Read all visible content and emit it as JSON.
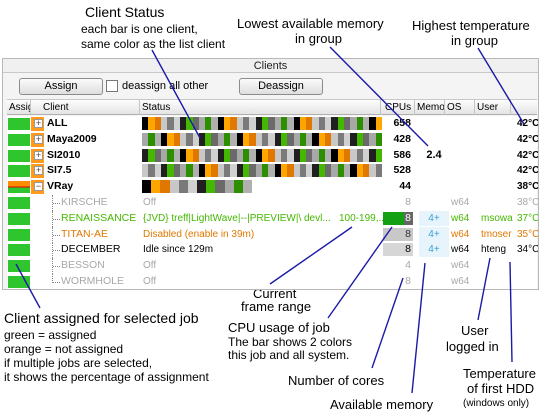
{
  "annotations": {
    "client_status": {
      "title": "Client Status",
      "line1": "each bar is one client,",
      "line2": "same color as the list client"
    },
    "lowest_memory": {
      "line1": "Lowest available memory",
      "line2": "in group"
    },
    "highest_temp": {
      "line1": "Highest temperature",
      "line2": "in group"
    },
    "frame_range": {
      "line1": "Current",
      "line2": "frame range"
    },
    "cpu_usage": {
      "line1": "CPU usage of job",
      "line2": "The bar shows 2 colors",
      "line3": "this job and all system."
    },
    "user": {
      "line1": "User",
      "line2": "logged in"
    },
    "client_assigned": {
      "line1": "Client assigned for selected job",
      "line2": "green = assigned",
      "line3": "orange = not assigned",
      "line4": "if multiple jobs are selected,",
      "line5": "it shows the percentage of assignment"
    },
    "cores": {
      "line1": "Number of cores"
    },
    "available_memory": {
      "line1": "Available memory"
    },
    "temp_hdd": {
      "line1": "Temperature",
      "line2": "of first HDD",
      "line3": "(windows only)"
    }
  },
  "panel": {
    "title": "Clients",
    "assign_label": "Assign",
    "deassign_all_label": "deassign all other",
    "deassign_label": "Deassign",
    "columns": [
      "Assig",
      "Client",
      "Status",
      "CPUs",
      "Memo",
      "OS",
      "User"
    ]
  },
  "groups": [
    {
      "name": "ALL",
      "cpus": "658",
      "mem": "",
      "temp": "42°C"
    },
    {
      "name": "Maya2009",
      "cpus": "428",
      "mem": "",
      "temp": "42°C"
    },
    {
      "name": "SI2010",
      "cpus": "586",
      "mem": "2.4",
      "temp": "42°C"
    },
    {
      "name": "SI7.5",
      "cpus": "528",
      "mem": "",
      "temp": "42°C"
    },
    {
      "name": "VRay",
      "cpus": "44",
      "mem": "",
      "temp": "38°C"
    }
  ],
  "clients": [
    {
      "name": "KIRSCHE",
      "status": "Off",
      "cpus": "8",
      "mem": "",
      "os": "w64",
      "user": "",
      "temp": "38°C",
      "color": "#a8a8a8"
    },
    {
      "name": "RENAISSANCE",
      "status": "{JVD} treff|LightWave|--|PREVIEW|\\ devl...",
      "range": "100-199,...",
      "cpus": "8",
      "mem": "4+",
      "os": "w64",
      "user": "msowa",
      "temp": "37°C",
      "color": "#44b800"
    },
    {
      "name": "TITAN-AE",
      "status": "Disabled (enable in 39m)",
      "cpus": "8",
      "mem": "4+",
      "os": "w64",
      "user": "tmoser",
      "temp": "35°C",
      "color": "#e07800"
    },
    {
      "name": "DECEMBER",
      "status": "Idle since 129m",
      "cpus": "8",
      "mem": "4+",
      "os": "w64",
      "user": "hteng",
      "temp": "34°C",
      "color": "#000000"
    },
    {
      "name": "BESSON",
      "status": "Off",
      "cpus": "4",
      "mem": "",
      "os": "w64",
      "user": "",
      "temp": "",
      "color": "#a8a8a8"
    },
    {
      "name": "WORMHOLE",
      "status": "Off",
      "cpus": "8",
      "mem": "",
      "os": "w64",
      "user": "",
      "temp": "",
      "color": "#a8a8a8"
    }
  ],
  "colors": {
    "assigned": "#2fc52f",
    "not_assigned": "#ff8c00",
    "pointer": "#1a1aa8"
  }
}
